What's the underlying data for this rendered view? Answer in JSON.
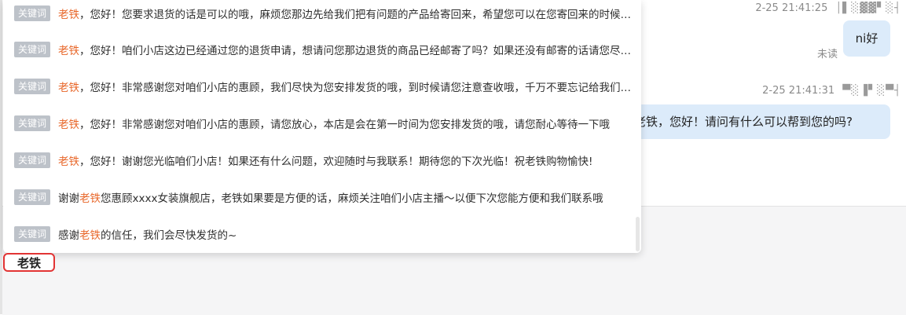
{
  "chat": {
    "messages": [
      {
        "time": "2-25 21:41:25",
        "meta": "│▌░▓▓▘░┤",
        "text": "ni好",
        "status": "未读"
      },
      {
        "time": "2-25 21:41:31",
        "meta": "▀░▐▘░▀┤",
        "text": "老铁，您好！请问有什么可以帮到您的吗?"
      }
    ]
  },
  "suggestions": {
    "badge": "关键词",
    "items": [
      {
        "pre": "",
        "kw": "老铁",
        "post": "，您好！您要求退货的话是可以的哦，麻烦您那边先给我们把有问题的产品给寄回来，希望您可以在您寄回来的时候附上您的订单号"
      },
      {
        "pre": "",
        "kw": "老铁",
        "post": "，您好！咱们小店这边已经通过您的退货申请，想请问您那边退货的商品已经邮寄了吗？如果还没有邮寄的话请您尽快处理哦"
      },
      {
        "pre": "",
        "kw": "老铁",
        "post": "，您好！非常感谢您对咱们小店的惠顾，我们尽快为您安排发货的哦，到时候请您注意查收哦，千万不要忘记给我们好评"
      },
      {
        "pre": "",
        "kw": "老铁",
        "post": "，您好！非常感谢您对咱们小店的惠顾，请您放心，本店是会在第一时间为您安排发货的哦，请您耐心等待一下哦"
      },
      {
        "pre": "",
        "kw": "老铁",
        "post": "，您好！谢谢您光临咱们小店！如果还有什么问题，欢迎随时与我联系！期待您的下次光临！祝老铁购物愉快!"
      },
      {
        "pre": "谢谢",
        "kw": "老铁",
        "post": "您惠顾xxxx女装旗舰店，老铁如果要是方便的话，麻烦关注咱们小店主播～以便下次您能方便和我们联系哦"
      },
      {
        "pre": "感谢",
        "kw": "老铁",
        "post": "的信任，我们会尽快发货的~"
      }
    ]
  },
  "input": {
    "value": "老铁"
  },
  "colors": {
    "accent": "#e8672a",
    "highlight_border": "#e23434",
    "bubble": "#dcebfa",
    "badge": "#bdc2c9"
  }
}
